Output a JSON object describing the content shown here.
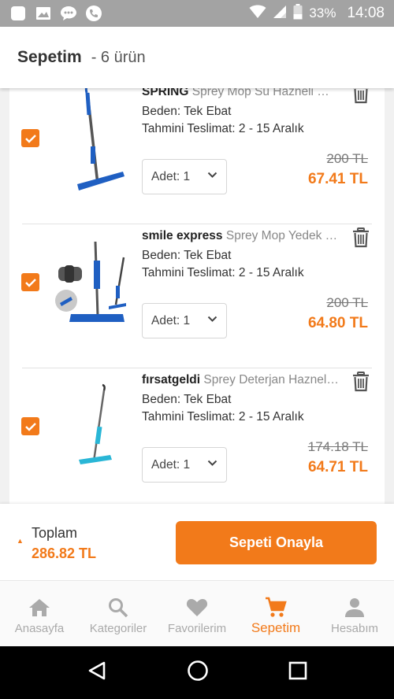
{
  "status_bar": {
    "battery": "33%",
    "time": "14:08"
  },
  "header": {
    "title": "Sepetim",
    "count": "- 6 ürün"
  },
  "items": [
    {
      "brand": "SPRİNG",
      "name": "Sprey Mop Su Hazneli Mikrofiber",
      "size": "Beden: Tek Ebat",
      "delivery": "Tahmini Teslimat: 2 - 15 Aralık",
      "qty": "Adet: 1",
      "old_price": "200 TL",
      "new_price": "67.41 TL",
      "thumb_color": "#1f5fc2"
    },
    {
      "brand": "smile express",
      "name": "Sprey Mop Yedek Başlık",
      "size": "Beden: Tek Ebat",
      "delivery": "Tahmini Teslimat: 2 - 15 Aralık",
      "qty": "Adet: 1",
      "old_price": "200 TL",
      "new_price": "64.80 TL",
      "thumb_color": "#1f5fc2"
    },
    {
      "brand": "fırsatgeldi",
      "name": "Sprey Deterjan Hazneli Mop",
      "size": "Beden: Tek Ebat",
      "delivery": "Tahmini Teslimat: 2 - 15 Aralık",
      "qty": "Adet: 1",
      "old_price": "174.18 TL",
      "new_price": "64.71 TL",
      "thumb_color": "#29b6d6"
    }
  ],
  "summary": {
    "total_label": "Toplam",
    "total_value": "286.82 TL",
    "confirm_label": "Sepeti Onayla"
  },
  "nav": [
    {
      "label": "Anasayfa",
      "icon": "home-icon"
    },
    {
      "label": "Kategoriler",
      "icon": "search-icon"
    },
    {
      "label": "Favorilerim",
      "icon": "heart-icon"
    },
    {
      "label": "Sepetim",
      "icon": "cart-icon",
      "active": true
    },
    {
      "label": "Hesabım",
      "icon": "user-icon"
    }
  ],
  "colors": {
    "accent": "#f27a1a",
    "nav_inactive": "#aaaaaa"
  }
}
